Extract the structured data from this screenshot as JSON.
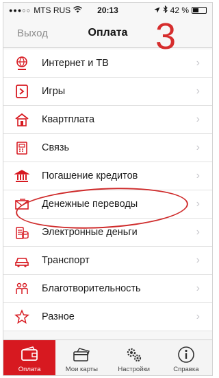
{
  "status_bar": {
    "signal": "●●●○○",
    "carrier": "MTS RUS",
    "time": "20:13",
    "battery": "42 %"
  },
  "nav": {
    "back_label": "Выход",
    "title": "Оплата",
    "annotation_number": "3"
  },
  "menu": [
    {
      "label": "Интернет и ТВ",
      "icon": "globe-icon"
    },
    {
      "label": "Игры",
      "icon": "games-icon"
    },
    {
      "label": "Квартплата",
      "icon": "house-icon"
    },
    {
      "label": "Связь",
      "icon": "phone-icon"
    },
    {
      "label": "Погашение кредитов",
      "icon": "bank-icon"
    },
    {
      "label": "Денежные переводы",
      "icon": "envelope-icon"
    },
    {
      "label": "Электронные деньги",
      "icon": "coins-icon"
    },
    {
      "label": "Транспорт",
      "icon": "car-icon"
    },
    {
      "label": "Благотворительность",
      "icon": "charity-icon"
    },
    {
      "label": "Разное",
      "icon": "star-icon"
    }
  ],
  "tabs": [
    {
      "label": "Оплата",
      "icon": "wallet-icon",
      "active": true
    },
    {
      "label": "Мои карты",
      "icon": "cards-icon",
      "active": false
    },
    {
      "label": "Настройки",
      "icon": "gears-icon",
      "active": false
    },
    {
      "label": "Справка",
      "icon": "info-icon",
      "active": false
    }
  ],
  "colors": {
    "accent": "#d71920",
    "annotation": "#cf2b2b",
    "chevron": "#c7c7cc"
  }
}
